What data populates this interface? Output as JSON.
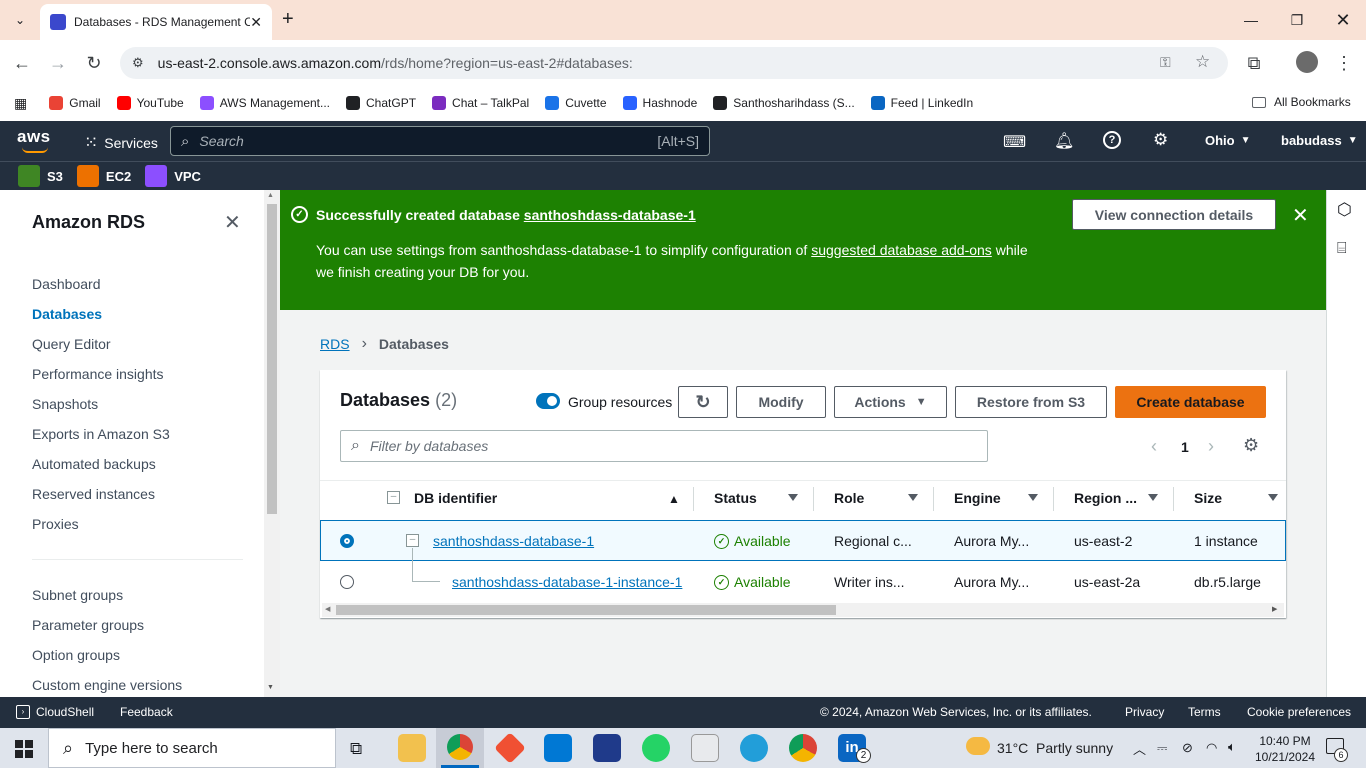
{
  "browser": {
    "tab_title": "Databases - RDS Management C",
    "url_host": "us-east-2.console.aws.amazon.com",
    "url_path": "/rds/home?region=us-east-2#databases:",
    "bookmarks": [
      {
        "label": "Gmail",
        "color": "#ea4335"
      },
      {
        "label": "YouTube",
        "color": "#ff0000"
      },
      {
        "label": "AWS Management...",
        "color": "#8c4fff"
      },
      {
        "label": "ChatGPT",
        "color": "#202124"
      },
      {
        "label": "Chat – TalkPal",
        "color": "#7b2cbf"
      },
      {
        "label": "Cuvette",
        "color": "#1a73e8"
      },
      {
        "label": "Hashnode",
        "color": "#2962ff"
      },
      {
        "label": "Santhosharihdass (S...",
        "color": "#202124"
      },
      {
        "label": "Feed | LinkedIn",
        "color": "#0a66c2"
      }
    ],
    "all_bookmarks": "All Bookmarks"
  },
  "aws_header": {
    "logo": "aws",
    "services": "Services",
    "search_placeholder": "Search",
    "search_shortcut": "[Alt+S]",
    "region": "Ohio",
    "user": "babudass",
    "favorites": [
      {
        "label": "S3",
        "color": "#3f8624"
      },
      {
        "label": "EC2",
        "color": "#ed7100"
      },
      {
        "label": "VPC",
        "color": "#8c4fff"
      }
    ]
  },
  "sidebar": {
    "title": "Amazon RDS",
    "items": [
      "Dashboard",
      "Databases",
      "Query Editor",
      "Performance insights",
      "Snapshots",
      "Exports in Amazon S3",
      "Automated backups",
      "Reserved instances",
      "Proxies"
    ],
    "items2": [
      "Subnet groups",
      "Parameter groups",
      "Option groups",
      "Custom engine versions"
    ],
    "active": "Databases"
  },
  "flash": {
    "title_prefix": "Successfully created database ",
    "db_name": "santhoshdass-database-1",
    "body_1": "You can use settings from santhoshdass-database-1 to simplify configuration of ",
    "body_link": "suggested database add-ons",
    "body_2": " while",
    "body_3": "we finish creating your DB for you.",
    "button": "View connection details"
  },
  "breadcrumb": {
    "root": "RDS",
    "current": "Databases"
  },
  "databases": {
    "title": "Databases",
    "count": "(2)",
    "group_resources": "Group resources",
    "modify": "Modify",
    "actions": "Actions",
    "restore": "Restore from S3",
    "create": "Create database",
    "filter_placeholder": "Filter by databases",
    "page": "1",
    "columns": [
      "DB identifier",
      "Status",
      "Role",
      "Engine",
      "Region ...",
      "Size"
    ],
    "rows": [
      {
        "id": "santhoshdass-database-1",
        "status": "Available",
        "role": "Regional c...",
        "engine": "Aurora My...",
        "region": "us-east-2",
        "size": "1 instance"
      },
      {
        "id": "santhoshdass-database-1-instance-1",
        "status": "Available",
        "role": "Writer ins...",
        "engine": "Aurora My...",
        "region": "us-east-2a",
        "size": "db.r5.large"
      }
    ]
  },
  "footer": {
    "cloudshell": "CloudShell",
    "feedback": "Feedback",
    "copyright": "© 2024, Amazon Web Services, Inc. or its affiliates.",
    "privacy": "Privacy",
    "terms": "Terms",
    "cookies": "Cookie preferences"
  },
  "taskbar": {
    "search": "Type here to search",
    "weather": "31°C  Partly sunny",
    "time": "10:40 PM",
    "date": "10/21/2024",
    "notifications": "6",
    "linkedin_badge": "2"
  },
  "colors": {
    "aws_dark": "#232f3e",
    "success": "#1d8102",
    "primary": "#ec7211",
    "link": "#0073bb"
  }
}
